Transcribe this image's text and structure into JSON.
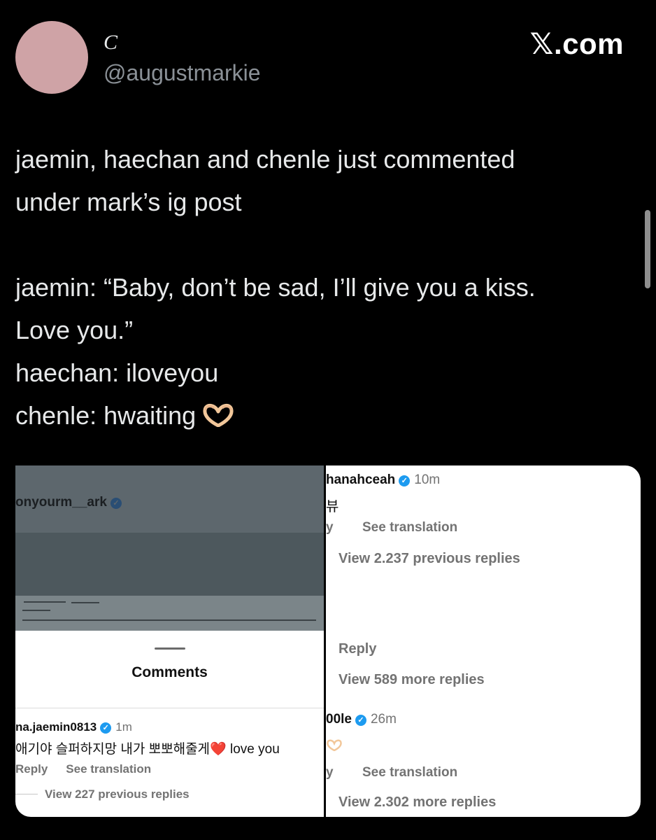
{
  "header": {
    "display_name": "C",
    "handle": "@augustmarkie",
    "brand_x": "𝕏",
    "brand_rest": ".com"
  },
  "tweet": {
    "lines": [
      "jaemin, haechan and chenle just commented",
      "under mark’s ig post",
      "",
      "jaemin: “Baby, don’t be sad, I’ll give you a kiss.",
      "Love you.”",
      "haechan: iloveyou",
      "chenle: hwaiting"
    ],
    "emoji": "heart-hands-emoji"
  },
  "left_screenshot": {
    "post_username": "onyourm__ark",
    "comments_title": "Comments",
    "comment": {
      "username": "na.jaemin0813",
      "time": "1m",
      "text": "애기야 슬퍼하지망 내가 뽀뽀해줄게",
      "emoji": "❤️",
      "text_after": " love you",
      "reply": "Reply",
      "see_translation": "See translation",
      "view_previous": "View 227 previous replies"
    }
  },
  "right_screenshot": {
    "comment1": {
      "username": "hanahceah",
      "time": "10m",
      "text": "뷰",
      "reply_fragment": "y",
      "see_translation": "See translation",
      "view_previous": "View 2.237 previous replies"
    },
    "reply_label": "Reply",
    "view_more_1": "View 589 more replies",
    "comment2": {
      "username": "00le",
      "time": "26m",
      "reply_fragment": "y",
      "see_translation": "See translation",
      "view_more": "View 2.302 more replies"
    }
  },
  "colors": {
    "background": "#000000",
    "text": "#e7e9ea",
    "muted": "#8b9197",
    "verified": "#1d9bf0",
    "avatar": "#cfa3a6"
  }
}
